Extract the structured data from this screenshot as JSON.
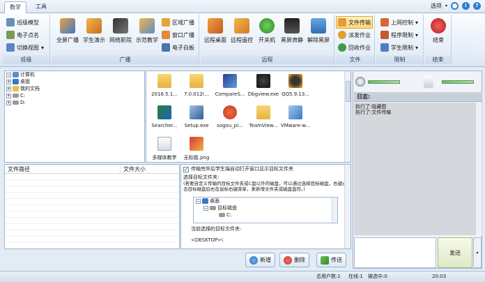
{
  "tabs": [
    "数学",
    "工具"
  ],
  "topright": {
    "options": "选项",
    "icons": [
      "refresh-icon",
      "info-icon",
      "help-icon"
    ]
  },
  "ribbon": {
    "class_group": {
      "label": "班级",
      "items": [
        "班级模型",
        "电子点名",
        "切换视图"
      ]
    },
    "broadcast_group": {
      "label": "广播",
      "big": [
        "全屏广播",
        "学生演示",
        "网络影院",
        "示范教学"
      ],
      "small": [
        "区域广播",
        "窗口广播",
        "电子白板"
      ]
    },
    "remote_group": {
      "label": "远程",
      "big": [
        "远程桌面",
        "远程遥控",
        "开关机",
        "黑屏肃静",
        "解除黑屏"
      ]
    },
    "file_group": {
      "label": "文件",
      "items": [
        "文件传输",
        "派发作业",
        "回收作业"
      ]
    },
    "limit_group": {
      "label": "限制",
      "items": [
        "上网控制",
        "程序限制",
        "学生限制"
      ]
    },
    "end_group": {
      "label": "结束",
      "big": [
        "结束"
      ]
    }
  },
  "tree": {
    "items": [
      "计算机",
      "桌面",
      "我的文档",
      "C:",
      "D:"
    ]
  },
  "files": {
    "items": [
      "2016.5.1...",
      "7.0.012(...",
      "CompareS...",
      "Dbgview.exe",
      "QQ5.9.13...",
      "Searcher...",
      "Setup.exe",
      "sogou_pi...",
      "TeamView...",
      "VMware-w...",
      "多媒体教学",
      "无标题.png"
    ]
  },
  "list": {
    "col_path": "文件路径",
    "col_size": "文件大小"
  },
  "options": {
    "checkbox": "传输完毕后学生端自动打开窗口显示目标文件夹",
    "target_label": "选择目标文件夹:",
    "hint": "(若要自定义传输的目标文件夹或C盘以外的磁盘，可以通过选择目标磁盘，右键点击目标磁盘后右击鼠标右键菜单，来新增文件夹或磁盘盘符。)",
    "subtree": [
      "桌面",
      "目标磁盘",
      "C:"
    ],
    "current_label": "当前选择的目标文件夹:",
    "current_value": "<DESKTOP>\\"
  },
  "actions": {
    "add": "新增",
    "delete": "删除",
    "send": "传送"
  },
  "right": {
    "log_title": "日志:",
    "log_lines": [
      "执行了:隐藏图",
      "执行了:文件传输"
    ],
    "send": "发送"
  },
  "status": {
    "total": "总用户数:1",
    "online": "在线:1",
    "selected": "被选中:0",
    "time": "20:03"
  },
  "colors": {
    "accent": "#3a78c8",
    "highlight": "#ffd874"
  }
}
